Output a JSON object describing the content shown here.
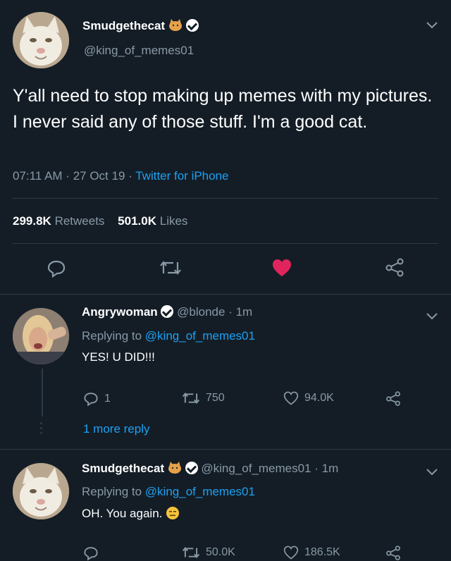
{
  "main_tweet": {
    "display_name": "Smudgethecat",
    "handle": "@king_of_memes01",
    "text": "Y'all need to stop making up memes with my pictures. I never said any of those stuff. I'm a good cat.",
    "time": "07:11 AM",
    "date": "27 Oct 19",
    "source": "Twitter for iPhone",
    "retweets_count": "299.8K",
    "retweets_label": "Retweets",
    "likes_count": "501.0K",
    "likes_label": "Likes"
  },
  "reply1": {
    "display_name": "Angrywoman",
    "handle": "@blonde",
    "time": "1m",
    "replying_label": "Replying to",
    "replying_to": "@king_of_memes01",
    "text": "YES! U DID!!!",
    "replies": "1",
    "retweets": "750",
    "likes": "94.0K",
    "more_replies": "1 more reply"
  },
  "reply2": {
    "display_name": "Smudgethecat",
    "handle": "@king_of_memes01",
    "time": "1m",
    "replying_label": "Replying to",
    "replying_to": "@king_of_memes01",
    "text": "OH. You again.",
    "retweets": "50.0K",
    "likes": "186.5K"
  },
  "colors": {
    "background": "#141d26",
    "accent": "#1da1f2",
    "like_active": "#e0245e",
    "muted": "#8899a6"
  }
}
